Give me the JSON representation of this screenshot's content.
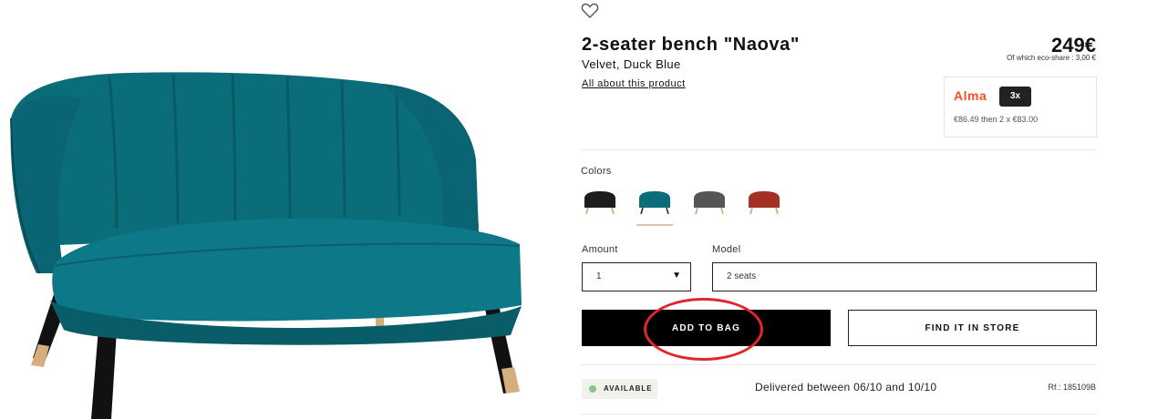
{
  "product": {
    "title": "2-seater bench \"Naova\"",
    "subtitle": "Velvet, Duck Blue",
    "about_link": "All about this product",
    "price": "249€",
    "eco_share": "Of which eco-share : 3,00 €"
  },
  "alma": {
    "logo": "Alma",
    "badge": "3x",
    "text": "€86.49 then 2 x €83.00"
  },
  "colors": {
    "label": "Colors",
    "swatches": [
      {
        "name": "black",
        "hex": "#1c1c1c"
      },
      {
        "name": "duck-blue",
        "hex": "#0b6d7a",
        "selected": true
      },
      {
        "name": "grey",
        "hex": "#555555"
      },
      {
        "name": "red",
        "hex": "#a33020"
      }
    ]
  },
  "amount": {
    "label": "Amount",
    "value": "1"
  },
  "model": {
    "label": "Model",
    "value": "2 seats"
  },
  "buttons": {
    "add_to_bag": "ADD TO BAG",
    "find_in_store": "FIND IT IN STORE"
  },
  "status": {
    "available": "AVAILABLE",
    "delivery": "Delivered between 06/10 and 10/10",
    "reference": "Rf.: 185109B"
  },
  "icons": {
    "wishlist": "heart-icon",
    "dropdown": "caret-down-icon"
  }
}
